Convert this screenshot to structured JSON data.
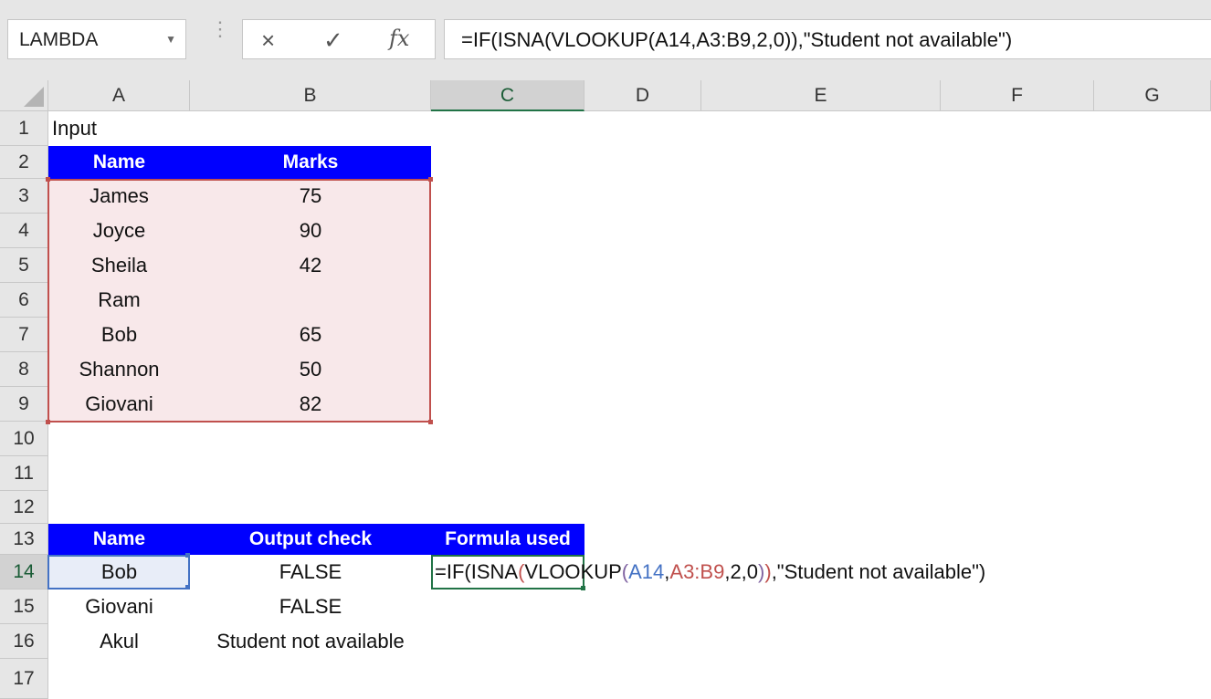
{
  "name_box": {
    "value": "LAMBDA"
  },
  "formula_bar": {
    "cancel_icon": "×",
    "enter_icon": "✓",
    "fx_label": "fx",
    "formula": "=IF(ISNA(VLOOKUP(A14,A3:B9,2,0)),\"Student not available\")"
  },
  "columns": [
    "A",
    "B",
    "C",
    "D",
    "E",
    "F",
    "G"
  ],
  "rows": [
    "1",
    "2",
    "3",
    "4",
    "5",
    "6",
    "7",
    "8",
    "9",
    "10",
    "11",
    "12",
    "13",
    "14",
    "15",
    "16",
    "17"
  ],
  "cells": {
    "A1": "Input",
    "A2": "Name",
    "B2": "Marks",
    "A3": "James",
    "B3": "75",
    "A4": "Joyce",
    "B4": "90",
    "A5": "Sheila",
    "B5": "42",
    "A6": "Ram",
    "B6": "",
    "A7": "Bob",
    "B7": "65",
    "A8": "Shannon",
    "B8": "50",
    "A9": "Giovani",
    "B9": "82",
    "A13": "Name",
    "B13": "Output check",
    "C13": "Formula used",
    "A14": "Bob",
    "B14": "FALSE",
    "A15": "Giovani",
    "B15": "FALSE",
    "A16": "Akul",
    "B16": "Student not available"
  },
  "edit_formula": {
    "p1": "=IF(ISNA",
    "p2": "(",
    "p3": "VLOOKUP",
    "p4": "(",
    "p5": "A14",
    "p6": ",",
    "p7": "A3:B9",
    "p8": ",2,0",
    "p9": ")",
    "p10": ")",
    "p11": ",\"Student not available\")"
  },
  "colors": {
    "header_fill": "#0000ff",
    "range_fill": "#f8e8ea",
    "range_border": "#c0504d",
    "ref_blue": "#4472c4",
    "excel_green": "#217346"
  }
}
